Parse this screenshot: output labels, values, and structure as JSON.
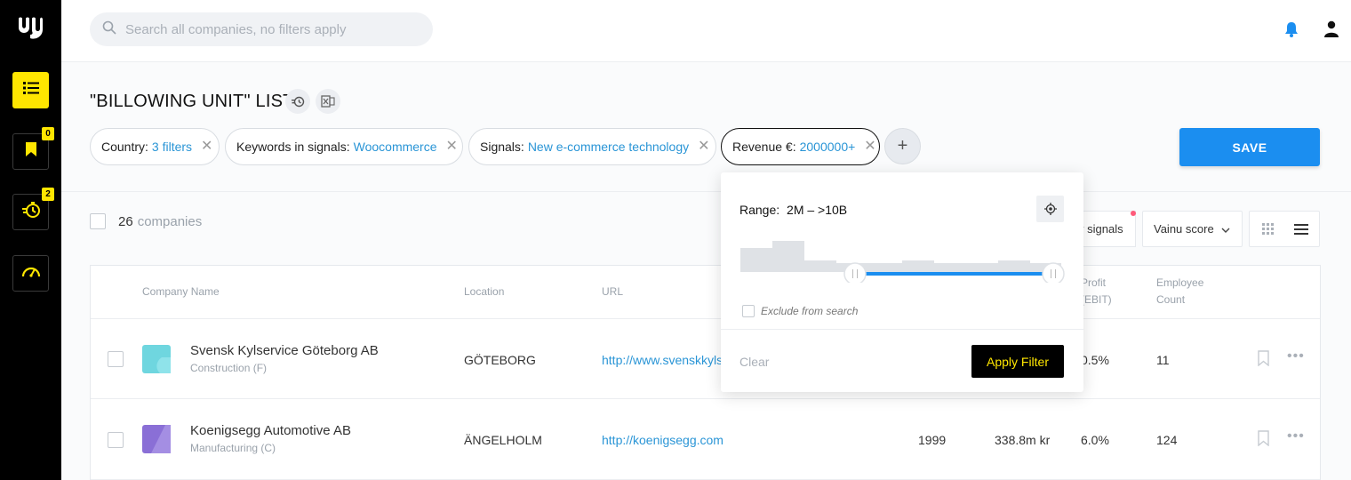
{
  "search": {
    "placeholder": "Search all companies, no filters apply"
  },
  "sidebar": {
    "items": [
      {
        "name": "list",
        "icon": "list-icon",
        "active": true
      },
      {
        "name": "bookmarks",
        "icon": "bookmark-icon",
        "badge": "0"
      },
      {
        "name": "signals",
        "icon": "signal-timer-icon",
        "badge": "2"
      },
      {
        "name": "dashboard",
        "icon": "gauge-icon"
      }
    ]
  },
  "header": {
    "title": "\"BILLOWING UNIT\" LIST",
    "save_label": "SAVE",
    "filters": [
      {
        "label": "Country:",
        "value": "3 filters"
      },
      {
        "label": "Keywords in signals:",
        "value": "Woocommerce"
      },
      {
        "label": "Signals:",
        "value": "New e-commerce technology"
      },
      {
        "label": "Revenue €:",
        "value": "2000000+"
      }
    ],
    "add_label": "+"
  },
  "list": {
    "count": "26",
    "count_label": "companies",
    "signals_label": "v signals",
    "sort_label": "Vainu score"
  },
  "table": {
    "columns": {
      "name": "Company Name",
      "location": "Location",
      "url": "URL",
      "profit_1": "Profit",
      "profit_2": "(EBIT)",
      "employee_1": "Employee",
      "employee_2": "Count"
    },
    "rows": [
      {
        "name": "Svensk Kylservice Göteborg AB",
        "type": "Construction (F)",
        "location": "GÖTEBORG",
        "url": "http://www.svenskkyls",
        "year": "",
        "revenue": "",
        "profit": "0.5%",
        "employees": "11",
        "logo_color": "#6fd6df"
      },
      {
        "name": "Koenigsegg Automotive AB",
        "type": "Manufacturing (C)",
        "location": "ÄNGELHOLM",
        "url": "http://koenigsegg.com",
        "year": "1999",
        "revenue": "338.8m kr",
        "profit": "6.0%",
        "employees": "124",
        "logo_color": "#8a6fd6"
      }
    ]
  },
  "popover": {
    "range_label": "Range:",
    "range_value": "2M – >10B",
    "exclude_label": "Exclude from search",
    "clear_label": "Clear",
    "apply_label": "Apply Filter"
  },
  "colors": {
    "accent_yellow": "#ffe600",
    "primary_blue": "#1b8ef0",
    "link_blue": "#2a95d6"
  }
}
